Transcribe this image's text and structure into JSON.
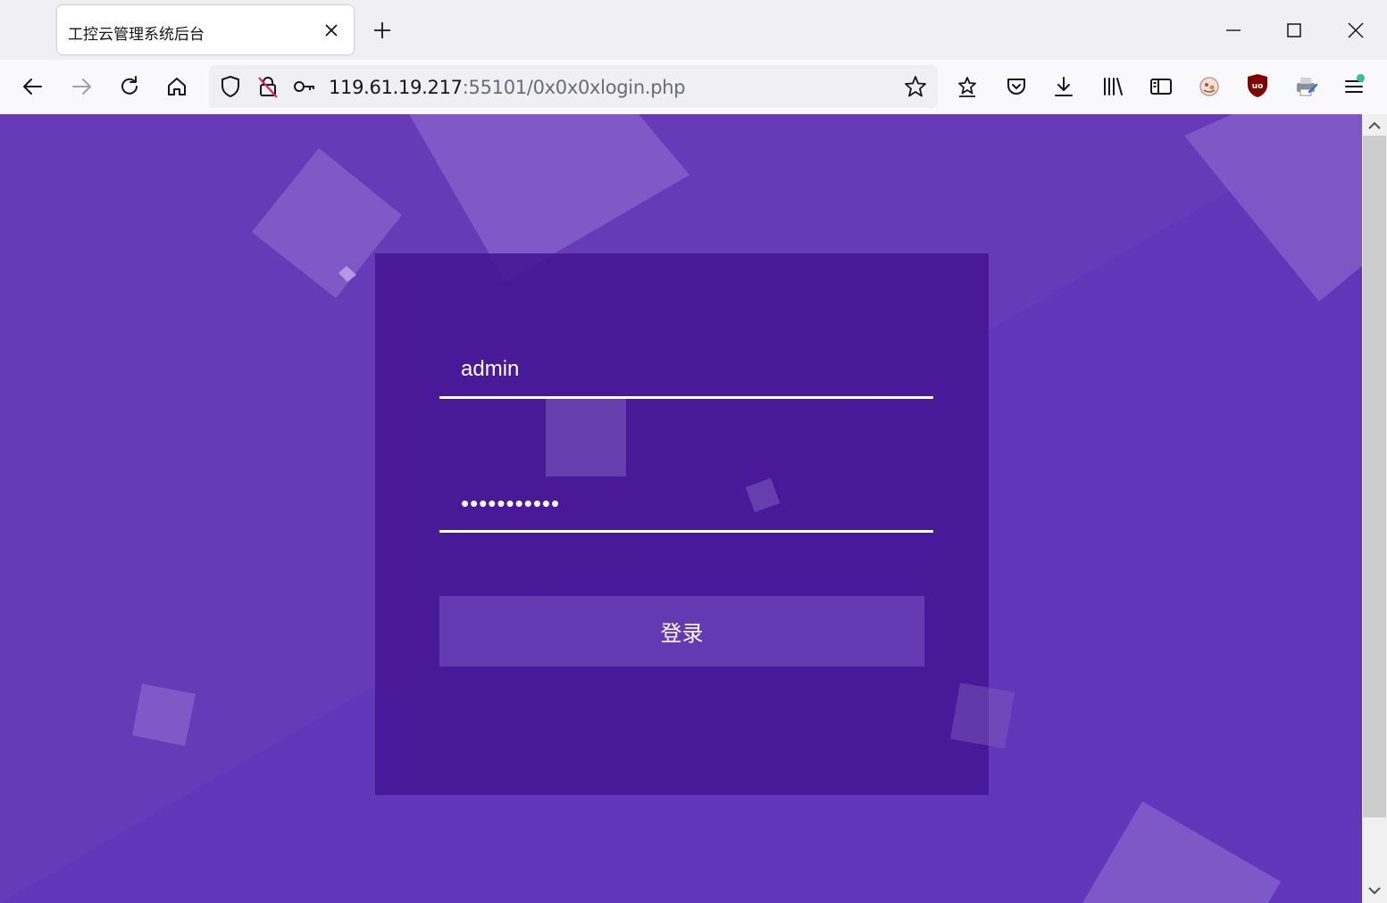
{
  "browser": {
    "tab_title": "工控云管理系统后台",
    "url_host": "119.61.19.217",
    "url_rest": ":55101/0x0x0xlogin.php"
  },
  "login": {
    "username_value": "admin",
    "password_value": "•••••••••••",
    "submit_label": "登录"
  },
  "colors": {
    "page_bg": "#6236b9",
    "card_bg": "#441694",
    "button_bg": "#6539b2",
    "accent_dot": "#2ac3a2"
  },
  "icons": {
    "tab_close": "close-icon",
    "new_tab": "plus-icon",
    "minimize": "minimize-icon",
    "maximize": "maximize-icon",
    "window_close": "close-icon",
    "back": "arrow-left-icon",
    "forward": "arrow-right-icon",
    "reload": "reload-icon",
    "home": "home-icon",
    "tracking": "shield-icon",
    "insecure": "lock-slash-icon",
    "password": "key-icon",
    "bookmark": "star-icon",
    "extensions": "star-list-icon",
    "pocket": "pocket-icon",
    "downloads": "download-icon",
    "library": "library-icon",
    "sidebar": "sidebar-icon",
    "menu": "hamburger-icon"
  }
}
